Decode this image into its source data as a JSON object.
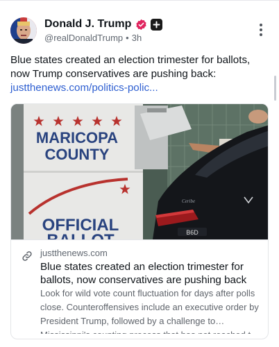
{
  "post": {
    "author": {
      "display_name": "Donald J. Trump",
      "handle": "@realDonaldTrump",
      "separator": "•",
      "time": "3h",
      "verified_badge_color": "#e0245e"
    },
    "text": "Blue states created an election trimester for ballots, now Trump conservatives are pushing back:",
    "link_text": "justthenews.com/politics-polic...",
    "link_color": "#2e5fd1",
    "more_icon": "vertical-ellipsis-icon"
  },
  "link_card": {
    "image": {
      "sign_lines": [
        "MARICOPA",
        "COUNTY"
      ],
      "sign_bottom": "OFFICIAL",
      "sign_bottom_partial": "BALLOT",
      "car_badge": "B6D",
      "star_color": "#b8322e",
      "sign_text_color": "#29437f"
    },
    "domain_icon": "link-icon",
    "domain": "justthenews.com",
    "title": "Blue states created an election trimester for ballots, now conservatives are pushing back",
    "description": "Look for wild vote count fluctuation for days after polls close. Counteroffensives include an executive order by President Trump, followed by a challenge to Mississippi's counting process that has not reached t..."
  }
}
